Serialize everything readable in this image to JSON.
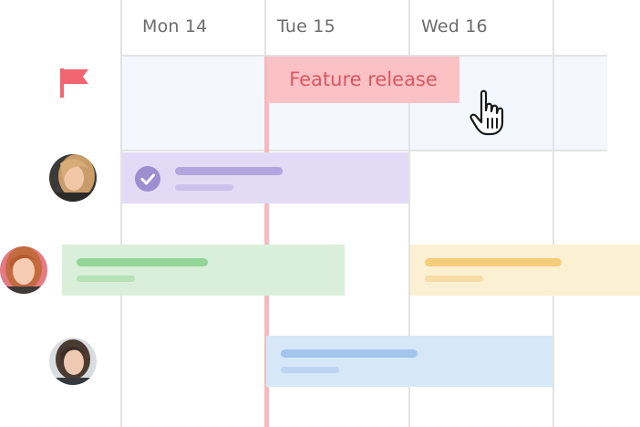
{
  "days": [
    {
      "label": "Mon 14"
    },
    {
      "label": "Tue 15"
    },
    {
      "label": "Wed 16"
    }
  ],
  "milestone": {
    "label": "Feature release",
    "icon": "flag-icon",
    "color": "#fcc1c4",
    "text_color": "#d95764"
  },
  "today_marker_color": "#f7b9bd",
  "grid_color": "#e3e3e3",
  "header_text_color": "#6b6b6b",
  "rows": [
    {
      "avatar": "avatar-woman-blonde",
      "tasks": [
        {
          "status": "completed",
          "icon": "check-circle-icon",
          "color": "#e2dbf6",
          "accent": "#b3a6df"
        }
      ]
    },
    {
      "avatar": "avatar-woman-redhead",
      "tasks": [
        {
          "status": "scheduled",
          "color": "#d9efd9",
          "accent": "#92d596"
        },
        {
          "status": "scheduled",
          "color": "#fcf0d3",
          "accent": "#f6cc7b"
        }
      ]
    },
    {
      "avatar": "avatar-woman-dark-hair",
      "tasks": [
        {
          "status": "scheduled",
          "color": "#d6e8f7",
          "accent": "#a3c4ed"
        }
      ]
    }
  ],
  "cursor": "hand-pointer-icon"
}
